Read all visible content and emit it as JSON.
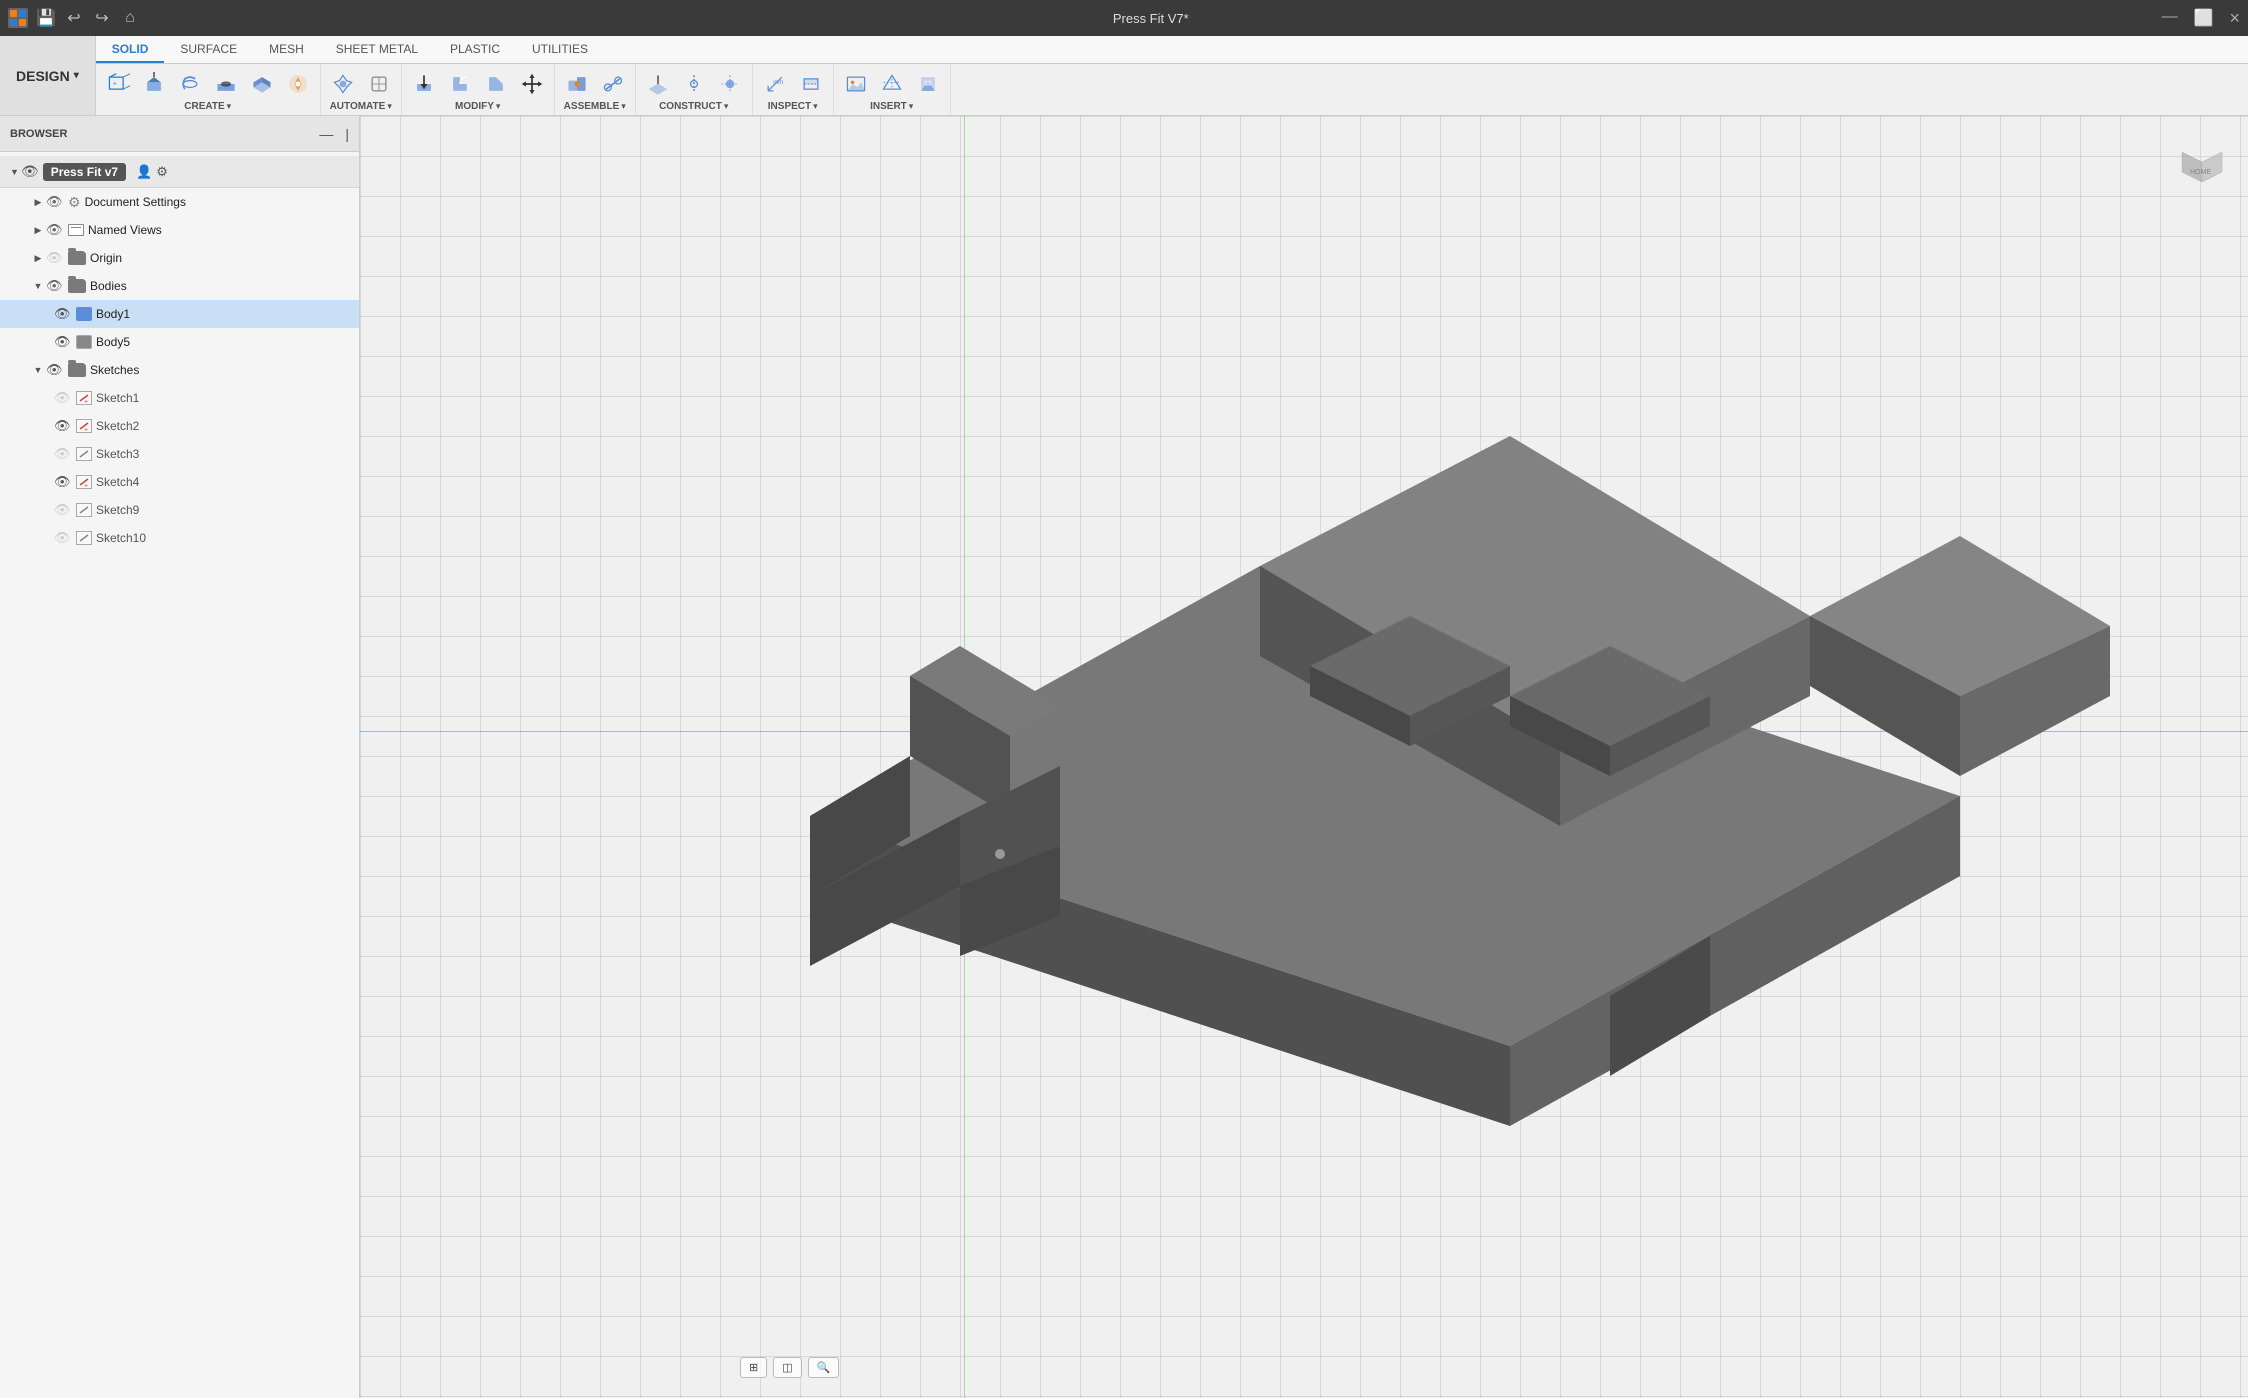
{
  "topbar": {
    "title": "Press Fit V7*",
    "close_label": "×",
    "maximize_label": "⬜",
    "minimize_label": "—"
  },
  "toolbar": {
    "design_label": "DESIGN",
    "design_arrow": "▾",
    "tabs": [
      {
        "id": "solid",
        "label": "SOLID",
        "active": true
      },
      {
        "id": "surface",
        "label": "SURFACE",
        "active": false
      },
      {
        "id": "mesh",
        "label": "MESH",
        "active": false
      },
      {
        "id": "sheet_metal",
        "label": "SHEET METAL",
        "active": false
      },
      {
        "id": "plastic",
        "label": "PLASTIC",
        "active": false
      },
      {
        "id": "utilities",
        "label": "UTILITIES",
        "active": false
      }
    ],
    "groups": [
      {
        "id": "create",
        "label": "CREATE",
        "has_arrow": true
      },
      {
        "id": "automate",
        "label": "AUTOMATE",
        "has_arrow": true
      },
      {
        "id": "modify",
        "label": "MODIFY",
        "has_arrow": true
      },
      {
        "id": "assemble",
        "label": "ASSEMBLE",
        "has_arrow": true
      },
      {
        "id": "construct",
        "label": "CONSTRUCT",
        "has_arrow": true
      },
      {
        "id": "inspect",
        "label": "INSPECT",
        "has_arrow": true
      },
      {
        "id": "insert",
        "label": "INSERT",
        "has_arrow": true
      }
    ]
  },
  "browser": {
    "title": "BROWSER",
    "collapse_label": "—",
    "panel_label": "|"
  },
  "tree": {
    "root": {
      "label": "Press Fit v7",
      "badge": "Press Fit v7"
    },
    "items": [
      {
        "id": "document-settings",
        "label": "Document Settings",
        "indent": 1,
        "expanded": false,
        "type": "settings",
        "visible": true
      },
      {
        "id": "named-views",
        "label": "Named Views",
        "indent": 1,
        "expanded": false,
        "type": "folder",
        "visible": true
      },
      {
        "id": "origin",
        "label": "Origin",
        "indent": 1,
        "expanded": false,
        "type": "folder",
        "visible": false
      },
      {
        "id": "bodies",
        "label": "Bodies",
        "indent": 1,
        "expanded": true,
        "type": "folder",
        "visible": true
      },
      {
        "id": "body1",
        "label": "Body1",
        "indent": 2,
        "expanded": false,
        "type": "body-blue",
        "visible": true,
        "selected": true
      },
      {
        "id": "body5",
        "label": "Body5",
        "indent": 2,
        "expanded": false,
        "type": "body-gray",
        "visible": true
      },
      {
        "id": "sketches",
        "label": "Sketches",
        "indent": 1,
        "expanded": true,
        "type": "folder",
        "visible": true
      },
      {
        "id": "sketch1",
        "label": "Sketch1",
        "indent": 2,
        "expanded": false,
        "type": "sketch-red",
        "visible": false
      },
      {
        "id": "sketch2",
        "label": "Sketch2",
        "indent": 2,
        "expanded": false,
        "type": "sketch-red",
        "visible": true
      },
      {
        "id": "sketch3",
        "label": "Sketch3",
        "indent": 2,
        "expanded": false,
        "type": "sketch-gray",
        "visible": false
      },
      {
        "id": "sketch4",
        "label": "Sketch4",
        "indent": 2,
        "expanded": false,
        "type": "sketch-red",
        "visible": true
      },
      {
        "id": "sketch9",
        "label": "Sketch9",
        "indent": 2,
        "expanded": false,
        "type": "sketch-gray",
        "visible": false
      },
      {
        "id": "sketch10",
        "label": "Sketch10",
        "indent": 2,
        "expanded": false,
        "type": "sketch-gray",
        "visible": false
      }
    ]
  },
  "viewport": {
    "grid_color": "#d0d0d0",
    "background_color": "#ebebeb"
  },
  "colors": {
    "accent_blue": "#2d7dd2",
    "toolbar_bg": "#f0f0f0",
    "sidebar_bg": "#f5f5f5",
    "selected_bg": "#c8dff5",
    "model_color": "#6a6a6a",
    "model_dark": "#555",
    "model_light": "#888"
  }
}
